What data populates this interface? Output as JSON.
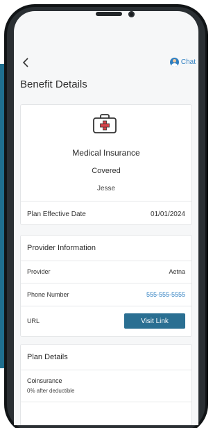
{
  "header": {
    "back_icon": "chevron-left-icon",
    "chat_label": "Chat"
  },
  "page": {
    "title": "Benefit Details"
  },
  "benefit": {
    "icon": "medical-briefcase-icon",
    "name": "Medical Insurance",
    "status": "Covered",
    "member": "Jesse",
    "effective_label": "Plan Effective Date",
    "effective_value": "01/01/2024"
  },
  "provider_info": {
    "heading": "Provider Information",
    "provider_label": "Provider",
    "provider_value": "Aetna",
    "phone_label": "Phone Number",
    "phone_value": "555-555-5555",
    "url_label": "URL",
    "visit_button": "Visit Link"
  },
  "plan_details": {
    "heading": "Plan Details",
    "coinsurance_label": "Coinsurance",
    "coinsurance_value": "0% after deductible"
  },
  "colors": {
    "accent": "#2f7fc1",
    "button": "#2a6f92",
    "left_strip": "#1f6f8f",
    "medical_cross": "#d9444b"
  }
}
